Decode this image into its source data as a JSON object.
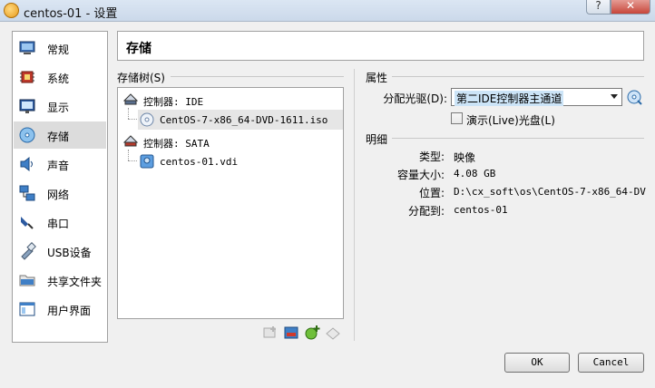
{
  "window": {
    "title": "centos-01 - 设置",
    "help_label": "?",
    "close_label": "✕"
  },
  "nav": {
    "items": [
      {
        "label": "常规",
        "icon": "general-icon"
      },
      {
        "label": "系统",
        "icon": "system-icon"
      },
      {
        "label": "显示",
        "icon": "display-icon"
      },
      {
        "label": "存储",
        "icon": "storage-icon",
        "active": true
      },
      {
        "label": "声音",
        "icon": "audio-icon"
      },
      {
        "label": "网络",
        "icon": "network-icon"
      },
      {
        "label": "串口",
        "icon": "serial-port-icon"
      },
      {
        "label": "USB设备",
        "icon": "usb-icon"
      },
      {
        "label": "共享文件夹",
        "icon": "shared-folder-icon"
      },
      {
        "label": "用户界面",
        "icon": "user-interface-icon"
      }
    ]
  },
  "header": {
    "title": "存储"
  },
  "storage_tree": {
    "title": "存储树(S)",
    "controllers": [
      {
        "label": "控制器: IDE",
        "devices": [
          {
            "label": "CentOS-7-x86_64-DVD-1611.iso",
            "type": "optical",
            "selected": true
          }
        ]
      },
      {
        "label": "控制器: SATA",
        "devices": [
          {
            "label": "centos-01.vdi",
            "type": "hard-disk"
          }
        ]
      }
    ]
  },
  "attributes": {
    "title": "属性",
    "drive_label": "分配光驱(D):",
    "drive_value": "第二IDE控制器主通道",
    "live_cd_label": "演示(Live)光盘(L)",
    "live_cd_checked": false
  },
  "details": {
    "title": "明细",
    "type_label": "类型:",
    "type_value": "映像",
    "size_label": "容量大小:",
    "size_value": "4.08  GB",
    "location_label": "位置:",
    "location_value": "D:\\cx_soft\\os\\CentOS-7-x86_64-DVD…",
    "attached_label": "分配到:",
    "attached_value": "centos-01"
  },
  "buttons": {
    "ok": "OK",
    "cancel": "Cancel"
  }
}
